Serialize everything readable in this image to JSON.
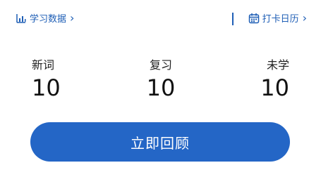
{
  "header": {
    "study_data_label": "学习数据",
    "checkin_calendar_label": "打卡日历"
  },
  "stats": {
    "new_words": {
      "label": "新词",
      "value": "10"
    },
    "review": {
      "label": "复习",
      "value": "10"
    },
    "unlearned": {
      "label": "未学",
      "value": "10"
    }
  },
  "actions": {
    "review_now_label": "立即回顾"
  },
  "colors": {
    "accent": "#1f5fb6",
    "button_bg": "#2466c6",
    "button_text": "#ffffff"
  },
  "icons": {
    "left": "bar-chart-icon",
    "right": "calendar-icon",
    "chevron": "chevron-right-icon"
  }
}
